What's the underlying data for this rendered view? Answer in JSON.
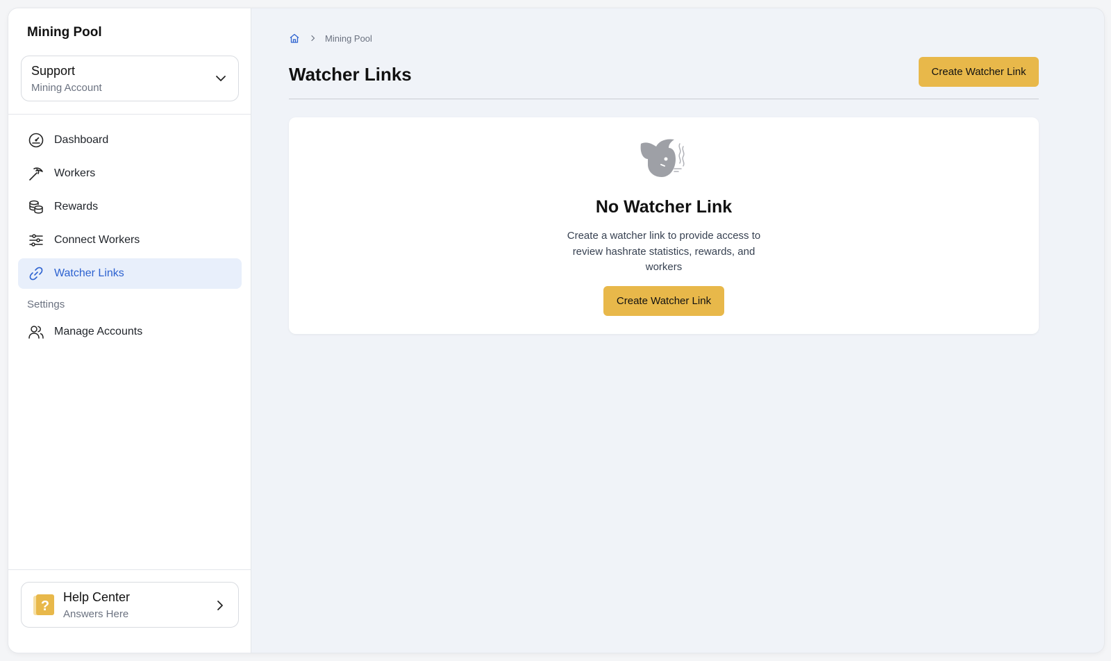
{
  "sidebar": {
    "brand": "Mining Pool",
    "account": {
      "name": "Support",
      "type": "Mining Account"
    },
    "nav": [
      {
        "label": "Dashboard",
        "icon": "gauge-icon"
      },
      {
        "label": "Workers",
        "icon": "pickaxe-icon"
      },
      {
        "label": "Rewards",
        "icon": "coins-icon"
      },
      {
        "label": "Connect Workers",
        "icon": "sliders-icon"
      },
      {
        "label": "Watcher Links",
        "icon": "link-icon",
        "active": true
      }
    ],
    "settings_label": "Settings",
    "settings_nav": [
      {
        "label": "Manage Accounts",
        "icon": "users-icon"
      }
    ],
    "help": {
      "title": "Help Center",
      "subtitle": "Answers Here"
    }
  },
  "main": {
    "breadcrumb": {
      "current": "Mining Pool"
    },
    "title": "Watcher Links",
    "create_button": "Create Watcher Link",
    "empty_state": {
      "title": "No Watcher Link",
      "description": "Create a watcher link to provide access to review hashrate statistics, rewards, and workers",
      "button": "Create Watcher Link"
    }
  },
  "colors": {
    "accent": "#e8b84a",
    "active_nav_bg": "#e8effb",
    "active_nav_text": "#2d62d0",
    "page_bg": "#f0f3f8"
  }
}
